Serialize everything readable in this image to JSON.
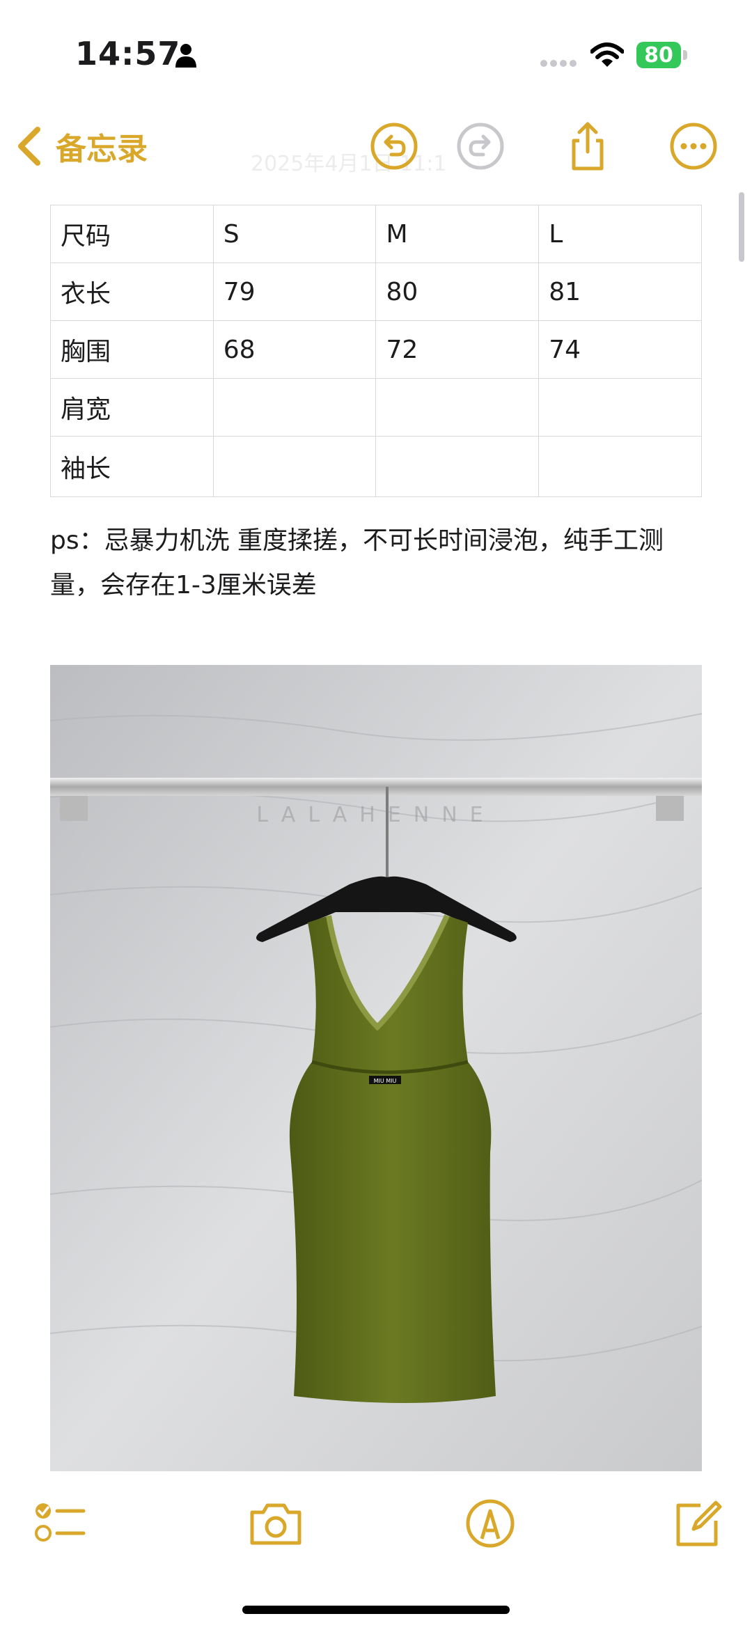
{
  "status_bar": {
    "time": "14:57",
    "battery_percent": "80"
  },
  "nav": {
    "back_label": "备忘录",
    "faded_date_text": "2025年4月1日 11:1"
  },
  "table": {
    "rows": [
      [
        "尺码",
        "S",
        "M",
        "L"
      ],
      [
        "衣长",
        "79",
        "80",
        "81"
      ],
      [
        "胸围",
        "68",
        "72",
        "74"
      ],
      [
        "肩宽",
        "",
        "",
        ""
      ],
      [
        "袖长",
        "",
        "",
        ""
      ]
    ]
  },
  "note": "ps：忌暴力机洗 重度揉搓，不可长时间浸泡，纯手工测量，会存在1-3厘米误差",
  "photo": {
    "watermark": "LALAHENNE",
    "label_text": "MIU MIU"
  },
  "colors": {
    "accent": "#d9a72a",
    "disabled": "#c7c7cc",
    "battery": "#34c759"
  },
  "icons": {
    "back": "chevron-left-icon",
    "undo": "undo-icon",
    "redo": "redo-icon",
    "share": "share-icon",
    "more": "more-icon",
    "checklist": "checklist-icon",
    "camera": "camera-icon",
    "markup": "markup-pen-icon",
    "compose": "compose-icon"
  }
}
